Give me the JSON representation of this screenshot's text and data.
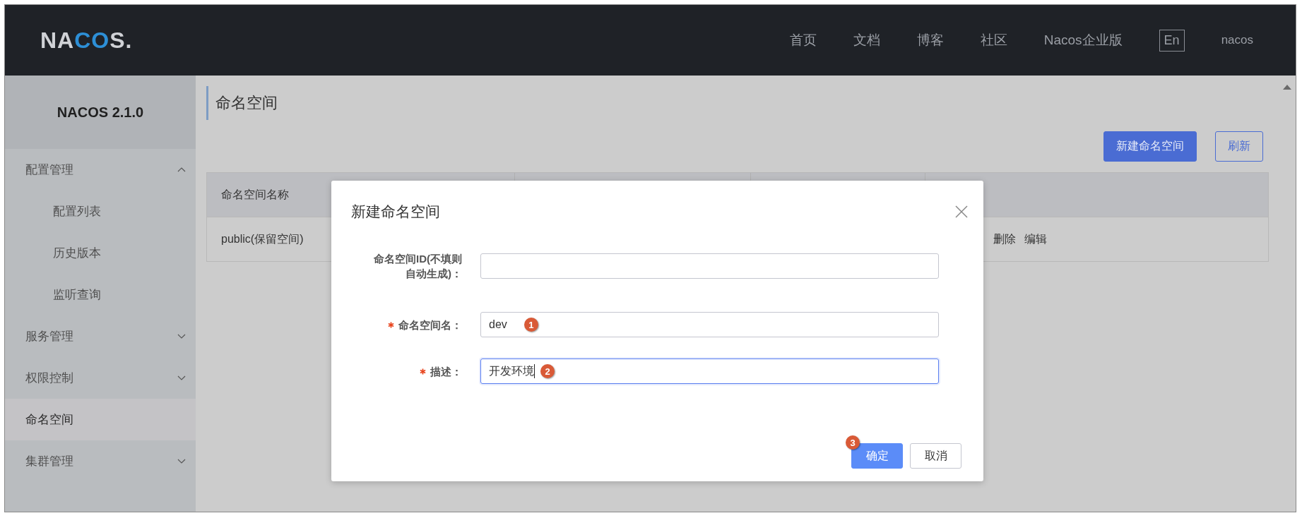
{
  "header": {
    "logo": [
      "NA",
      "CO",
      "S."
    ],
    "nav": [
      {
        "label": "首页"
      },
      {
        "label": "文档"
      },
      {
        "label": "博客"
      },
      {
        "label": "社区"
      },
      {
        "label": "Nacos企业版"
      }
    ],
    "language": "En",
    "user": "nacos"
  },
  "sidebar": {
    "title": "NACOS 2.1.0",
    "items": [
      {
        "label": "配置管理",
        "expanded": true,
        "selected": false,
        "children": [
          {
            "label": "配置列表",
            "selected": false
          },
          {
            "label": "历史版本",
            "selected": false
          },
          {
            "label": "监听查询",
            "selected": false
          }
        ]
      },
      {
        "label": "服务管理",
        "expanded": false,
        "selected": false
      },
      {
        "label": "权限控制",
        "expanded": false,
        "selected": false
      },
      {
        "label": "命名空间",
        "selected": true
      },
      {
        "label": "集群管理",
        "expanded": false,
        "selected": false
      }
    ]
  },
  "main": {
    "title": "命名空间",
    "buttons": [
      {
        "label": "新建命名空间",
        "kind": "primary"
      },
      {
        "label": "刷新",
        "kind": "outline"
      }
    ],
    "table": {
      "columns": [
        "命名空间名称"
      ],
      "rows": [
        {
          "cells": [
            "public(保留空间)"
          ],
          "actions": [
            "删除",
            "编辑"
          ]
        }
      ]
    }
  },
  "dialog": {
    "title": "新建命名空间",
    "fields": [
      {
        "label": "命名空间ID(不填则自动生成)：",
        "required": false,
        "focused": false
      },
      {
        "label": "命名空间名：",
        "required": true,
        "value": "dev",
        "focused": false,
        "marker": "1"
      },
      {
        "label": "描述：",
        "required": true,
        "value": "开发环境",
        "focused": true,
        "marker": "2"
      }
    ],
    "buttons": [
      {
        "label": "确定",
        "kind": "primary",
        "marker": "3"
      },
      {
        "label": "取消",
        "kind": "secondary"
      }
    ]
  }
}
